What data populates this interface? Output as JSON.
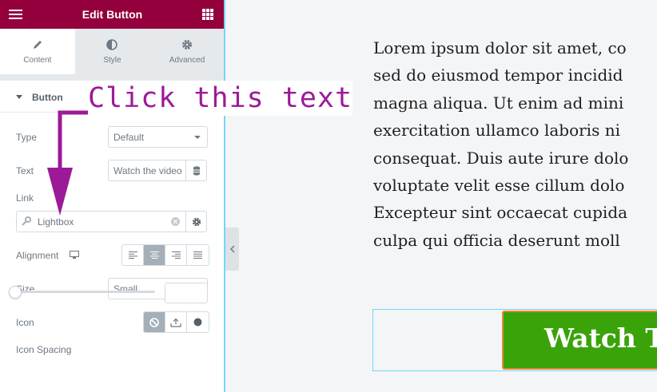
{
  "header": {
    "title": "Edit Button"
  },
  "tabs": [
    {
      "label": "Content",
      "icon": "pencil-icon",
      "active": true
    },
    {
      "label": "Style",
      "icon": "contrast-icon",
      "active": false
    },
    {
      "label": "Advanced",
      "icon": "gear-icon",
      "active": false
    }
  ],
  "section": {
    "title": "Button",
    "expanded": true
  },
  "controls": {
    "type": {
      "label": "Type",
      "value": "Default"
    },
    "text": {
      "label": "Text",
      "value": "Watch the video"
    },
    "link": {
      "label": "Link",
      "value": "Lightbox"
    },
    "alignment": {
      "label": "Alignment",
      "options": [
        "left",
        "center",
        "right",
        "justify"
      ],
      "selected": "center"
    },
    "size": {
      "label": "Size",
      "value": "Small"
    },
    "icon": {
      "label": "Icon",
      "options": [
        "none",
        "upload",
        "circle"
      ],
      "selected": "none"
    },
    "icon_spacing": {
      "label": "Icon Spacing",
      "value": ""
    }
  },
  "annotation": {
    "text": "Click this text",
    "color": "#9c1a98"
  },
  "preview": {
    "paragraph_lines": [
      "Lorem ipsum dolor sit amet, co",
      "sed do eiusmod tempor incidid",
      "magna aliqua. Ut enim ad mini",
      "exercitation ullamco laboris ni",
      "consequat. Duis aute irure dolo",
      "voluptate velit esse cillum dolo",
      "Excepteur sint occaecat cupida",
      "culpa qui officia deserunt moll"
    ],
    "button_label": "Watch Th",
    "button_color": "#3aa30a"
  },
  "colors": {
    "header": "#93003c",
    "accent_border": "#71d7f7"
  }
}
